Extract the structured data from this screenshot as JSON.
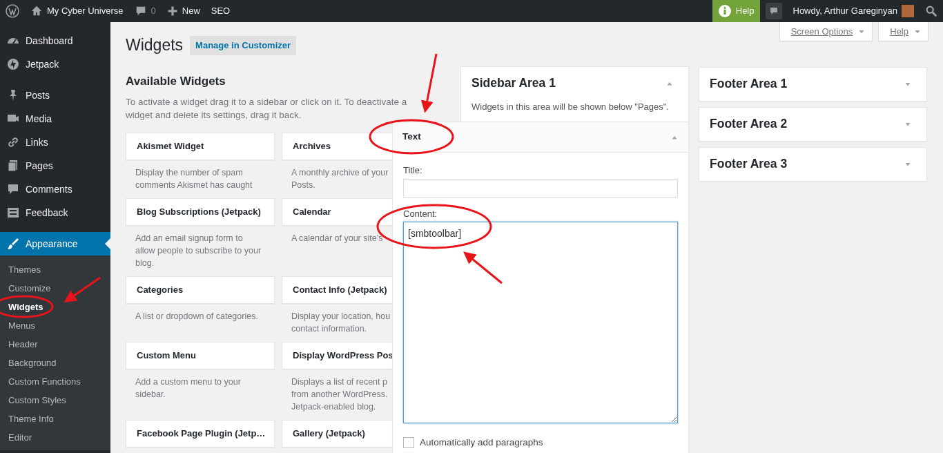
{
  "admin_bar": {
    "site_name": "My Cyber Universe",
    "comments_count": "0",
    "new_label": "New",
    "seo_label": "SEO",
    "help_label": "Help",
    "greeting": "Howdy, Arthur Gareginyan"
  },
  "sidebar": {
    "items": [
      {
        "kind": "link",
        "label": "Dashboard",
        "selected": false
      },
      {
        "kind": "link",
        "label": "Jetpack",
        "selected": false
      },
      {
        "kind": "separator"
      },
      {
        "kind": "link",
        "label": "Posts",
        "selected": false
      },
      {
        "kind": "link",
        "label": "Media",
        "selected": false
      },
      {
        "kind": "link",
        "label": "Links",
        "selected": false
      },
      {
        "kind": "link",
        "label": "Pages",
        "selected": false
      },
      {
        "kind": "link",
        "label": "Comments",
        "selected": false
      },
      {
        "kind": "link",
        "label": "Feedback",
        "selected": false
      },
      {
        "kind": "separator"
      },
      {
        "kind": "link",
        "label": "Appearance",
        "selected": true,
        "children": [
          {
            "label": "Themes",
            "selected": false
          },
          {
            "label": "Customize",
            "selected": false
          },
          {
            "label": "Widgets",
            "selected": true
          },
          {
            "label": "Menus",
            "selected": false
          },
          {
            "label": "Header",
            "selected": false
          },
          {
            "label": "Background",
            "selected": false
          },
          {
            "label": "Custom Functions",
            "selected": false
          },
          {
            "label": "Custom Styles",
            "selected": false
          },
          {
            "label": "Theme Info",
            "selected": false
          },
          {
            "label": "Editor",
            "selected": false
          }
        ]
      }
    ]
  },
  "screen_tabs": [
    {
      "label": "Screen Options"
    },
    {
      "label": "Help"
    }
  ],
  "page": {
    "title": "Widgets",
    "action": "Manage in Customizer"
  },
  "available_widgets": {
    "title": "Available Widgets",
    "description": "To activate a widget drag it to a sidebar or click on it. To deactivate a widget and delete its settings, drag it back.",
    "widgets": [
      {
        "title": "Akismet Widget",
        "description_lines": [
          "Display the number of spam",
          "comments Akismet has caught"
        ]
      },
      {
        "title": "Archives",
        "description_lines": [
          "A monthly archive of your",
          "Posts."
        ]
      },
      {
        "title": "Blog Subscriptions (Jetpack)",
        "description_lines": [
          "Add an email signup form to",
          "allow people to subscribe to your",
          "blog."
        ]
      },
      {
        "title": "Calendar",
        "description_lines": [
          "A calendar of your site’s"
        ]
      },
      {
        "title": "Categories",
        "description_lines": [
          "A list or dropdown of categories."
        ]
      },
      {
        "title": "Contact Info (Jetpack)",
        "description_lines": [
          "Display your location, hou",
          "contact information."
        ]
      },
      {
        "title": "Custom Menu",
        "description_lines": [
          "Add a custom menu to your",
          "sidebar."
        ]
      },
      {
        "title": "Display WordPress Pos",
        "description_lines": [
          "Displays a list of recent p",
          "from another WordPress.",
          "Jetpack-enabled blog."
        ]
      },
      {
        "title": "Facebook Page Plugin (Jetp…"
      },
      {
        "title": "Gallery (Jetpack)"
      }
    ]
  },
  "sidebars": [
    {
      "title": "Sidebar Area 1",
      "expanded": true,
      "description": "Widgets in this area will be shown below \"Pages\"."
    },
    {
      "title": "Footer Area 1",
      "expanded": false
    },
    {
      "title": "Footer Area 2",
      "expanded": false
    },
    {
      "title": "Footer Area 3",
      "expanded": false
    }
  ],
  "text_widget": {
    "title": "Text",
    "expanded": true,
    "title_label": "Title:",
    "content_label": "Content:",
    "content_value": "[smbtoolbar]",
    "checkbox_label": "Automatically add paragraphs",
    "checkbox_checked": false
  }
}
